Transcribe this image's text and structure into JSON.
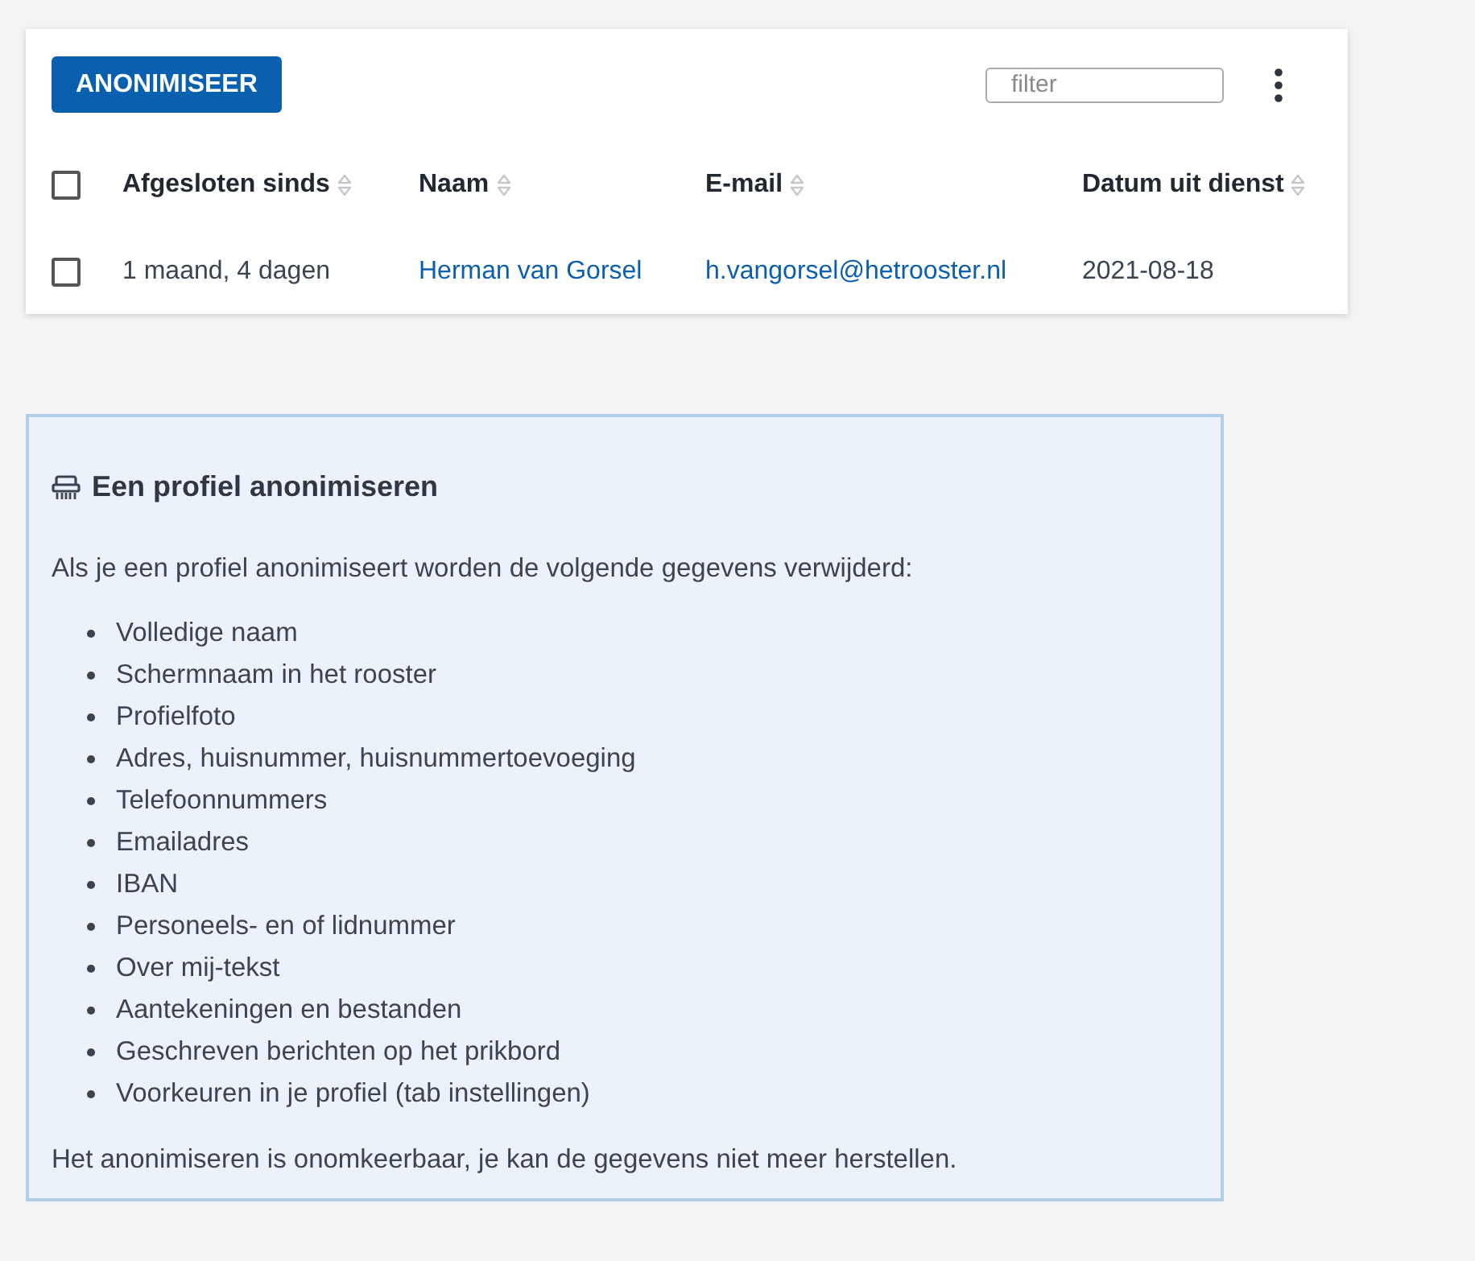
{
  "toolbar": {
    "button": "ANONIMISEER",
    "filter": {
      "placeholder": "filter"
    }
  },
  "table": {
    "header_checkbox": {
      "checked": false
    },
    "columns": [
      "Afgesloten sinds",
      "Naam",
      "E-mail",
      "Datum uit dienst"
    ],
    "rows": [
      {
        "checked": false,
        "cells": [
          {
            "kind": "text",
            "text": "1 maand, 4 dagen"
          },
          {
            "kind": "link",
            "text": "Herman van Gorsel"
          },
          {
            "kind": "link",
            "text": "h.vangorsel@hetrooster.nl"
          },
          {
            "kind": "text",
            "text": "2021-08-18"
          }
        ]
      }
    ]
  },
  "info_panel": {
    "title": "Een profiel anonimiseren",
    "intro": "Als je een profiel anonimiseert worden de volgende gegevens verwijderd:",
    "items": [
      "Volledige naam",
      "Schermnaam in het rooster",
      "Profielfoto",
      "Adres, huisnummer, huisnummertoevoeging",
      "Telefoonnummers",
      "Emailadres",
      "IBAN",
      "Personeels- en of lidnummer",
      "Over mij-tekst",
      "Aantekeningen en bestanden",
      "Geschreven berichten op het prikbord",
      "Voorkeuren in je profiel (tab instellingen)"
    ],
    "footer": "Het anonimiseren is onomkeerbaar, je kan de gegevens niet meer herstellen."
  }
}
